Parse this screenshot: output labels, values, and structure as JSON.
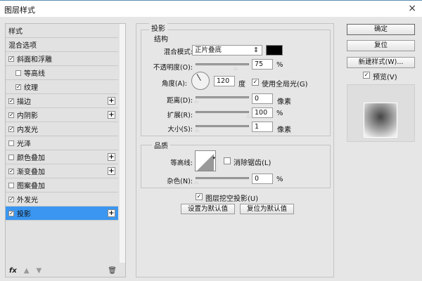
{
  "window": {
    "title": "图层样式",
    "close": "×"
  },
  "sidebar": {
    "items": [
      {
        "label": "样式",
        "check": null,
        "plus": false,
        "indent": 0
      },
      {
        "label": "混合选项",
        "check": null,
        "plus": false,
        "indent": 0
      },
      {
        "label": "斜面和浮雕",
        "check": true,
        "plus": false,
        "indent": 0
      },
      {
        "label": "等高线",
        "check": false,
        "plus": false,
        "indent": 1
      },
      {
        "label": "纹理",
        "check": true,
        "plus": false,
        "indent": 1
      },
      {
        "label": "描边",
        "check": true,
        "plus": true,
        "indent": 0
      },
      {
        "label": "内阴影",
        "check": true,
        "plus": true,
        "indent": 0
      },
      {
        "label": "内发光",
        "check": true,
        "plus": false,
        "indent": 0
      },
      {
        "label": "光泽",
        "check": false,
        "plus": false,
        "indent": 0
      },
      {
        "label": "颜色叠加",
        "check": false,
        "plus": true,
        "indent": 0
      },
      {
        "label": "渐变叠加",
        "check": true,
        "plus": true,
        "indent": 0
      },
      {
        "label": "图案叠加",
        "check": false,
        "plus": false,
        "indent": 0
      },
      {
        "label": "外发光",
        "check": true,
        "plus": false,
        "indent": 0
      },
      {
        "label": "投影",
        "check": true,
        "plus": true,
        "indent": 0,
        "selected": true
      }
    ],
    "fx": "fx"
  },
  "panel": {
    "title": "投影",
    "structure": {
      "title": "结构",
      "blend_label": "混合模式:",
      "blend_value": "正片叠底",
      "color": "#000000",
      "opacity_label": "不透明度(O):",
      "opacity": "75",
      "opacity_unit": "%",
      "angle_label": "角度(A):",
      "angle": "120",
      "angle_unit": "度",
      "global_light_label": "使用全局光(G)",
      "global_light": true,
      "distance_label": "距离(D):",
      "distance": "0",
      "distance_unit": "像素",
      "spread_label": "扩展(R):",
      "spread": "100",
      "spread_unit": "%",
      "size_label": "大小(S):",
      "size": "1",
      "size_unit": "像素"
    },
    "quality": {
      "title": "品质",
      "contour_label": "等高线:",
      "antialias_label": "消除锯齿(L)",
      "antialias": false,
      "noise_label": "杂色(N):",
      "noise": "0",
      "noise_unit": "%"
    },
    "knockout_label": "图层挖空投影(U)",
    "knockout": true,
    "set_default": "设置为默认值",
    "reset_default": "复位为默认值"
  },
  "right": {
    "ok": "确定",
    "reset": "复位",
    "new_style": "新建样式(W)...",
    "preview_label": "预览(V)",
    "preview": true
  },
  "colors": {
    "selected": "#3a96f0"
  }
}
